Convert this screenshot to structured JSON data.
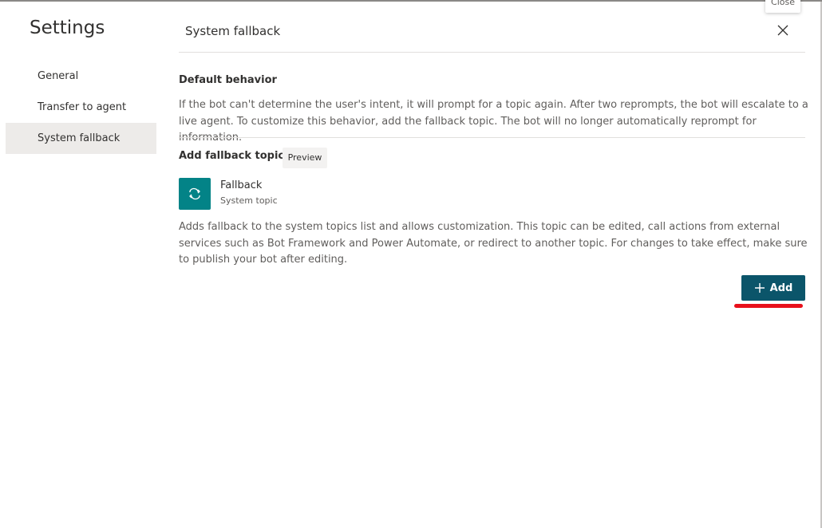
{
  "sidebar": {
    "title": "Settings",
    "items": [
      {
        "label": "General",
        "active": false
      },
      {
        "label": "Transfer to agent",
        "active": false
      },
      {
        "label": "System fallback",
        "active": true
      }
    ]
  },
  "header": {
    "title": "System fallback",
    "close_tooltip": "Close",
    "close_icon": "close-icon"
  },
  "default_behavior": {
    "heading": "Default behavior",
    "description": "If the bot can't determine the user's intent, it will prompt for a topic again. After two reprompts, the bot will escalate to a live agent. To customize this behavior, add the fallback topic. The bot will no longer automatically reprompt for information."
  },
  "fallback_topic": {
    "heading": "Add fallback topic",
    "badge": "Preview",
    "topic_icon": "loop-icon",
    "topic_name": "Fallback",
    "topic_type": "System topic",
    "description": "Adds fallback to the system topics list and allows customization. This topic can be edited, call actions from external services such as Bot Framework and Power Automate, or redirect to another topic. For changes to take effect, make sure to publish your bot after editing.",
    "add_label": "Add",
    "add_icon": "plus-icon"
  },
  "colors": {
    "accent": "#0b556a",
    "topic_tile": "#038387",
    "annotation_underline": "#e8101b",
    "active_nav_bg": "#edebe9"
  }
}
